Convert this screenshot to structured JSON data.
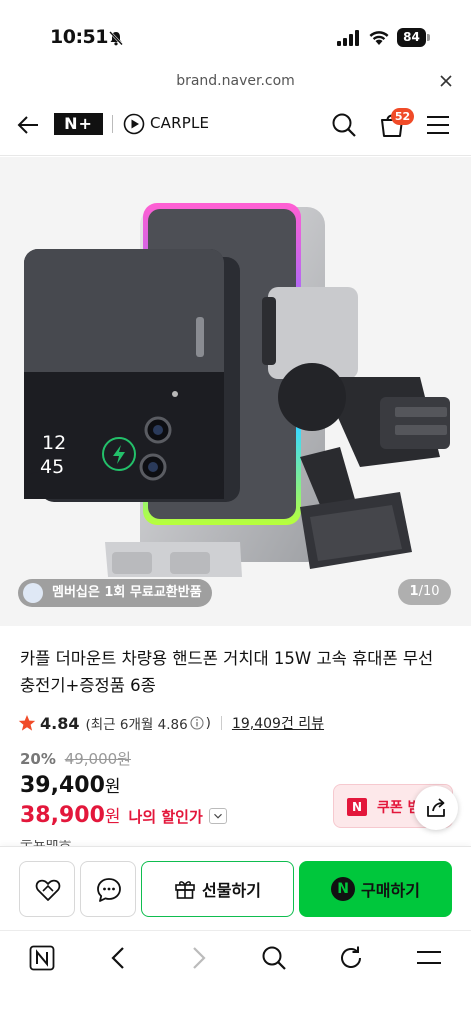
{
  "status_bar": {
    "time": "10:51",
    "battery": "84"
  },
  "browser": {
    "url": "brand.naver.com"
  },
  "header": {
    "logo": "N+",
    "brand": "CARPLE",
    "cart_count": "52"
  },
  "gallery": {
    "membership_badge": "멤버십은 1회 무료교환반품",
    "current_page": "1",
    "total_pages": "/10"
  },
  "product": {
    "title": "카플 더마운트 차량용 핸드폰 거치대 15W 고속 휴대폰 무선 충전기+증정품 6종",
    "rating": "4.84",
    "rating_detail": "(최근 6개월 4.86",
    "rating_detail_close": ")",
    "review_count": "19,409건 리뷰",
    "discount_rate": "20%",
    "original_price": "49,000원",
    "sale_price": "39,400",
    "currency": "원",
    "my_price": "38,900",
    "my_price_label": "나의 할인가",
    "coupon_label": "쿠폰 받",
    "peek_text": "무료배송"
  },
  "actions": {
    "gift_label": "선물하기",
    "buy_label": "구매하기",
    "npay_mark": "N"
  },
  "colors": {
    "accent_green": "#00c73c",
    "sale_red": "#e3173b",
    "cart_badge": "#f04b28"
  },
  "icons": [
    "back-icon",
    "search-icon",
    "cart-icon",
    "menu-icon",
    "star-icon",
    "info-icon",
    "share-icon",
    "heart-icon",
    "chat-icon",
    "gift-icon",
    "naver-home-icon",
    "browser-back-icon",
    "browser-forward-icon",
    "browser-search-icon",
    "refresh-icon",
    "browser-menu-icon"
  ]
}
